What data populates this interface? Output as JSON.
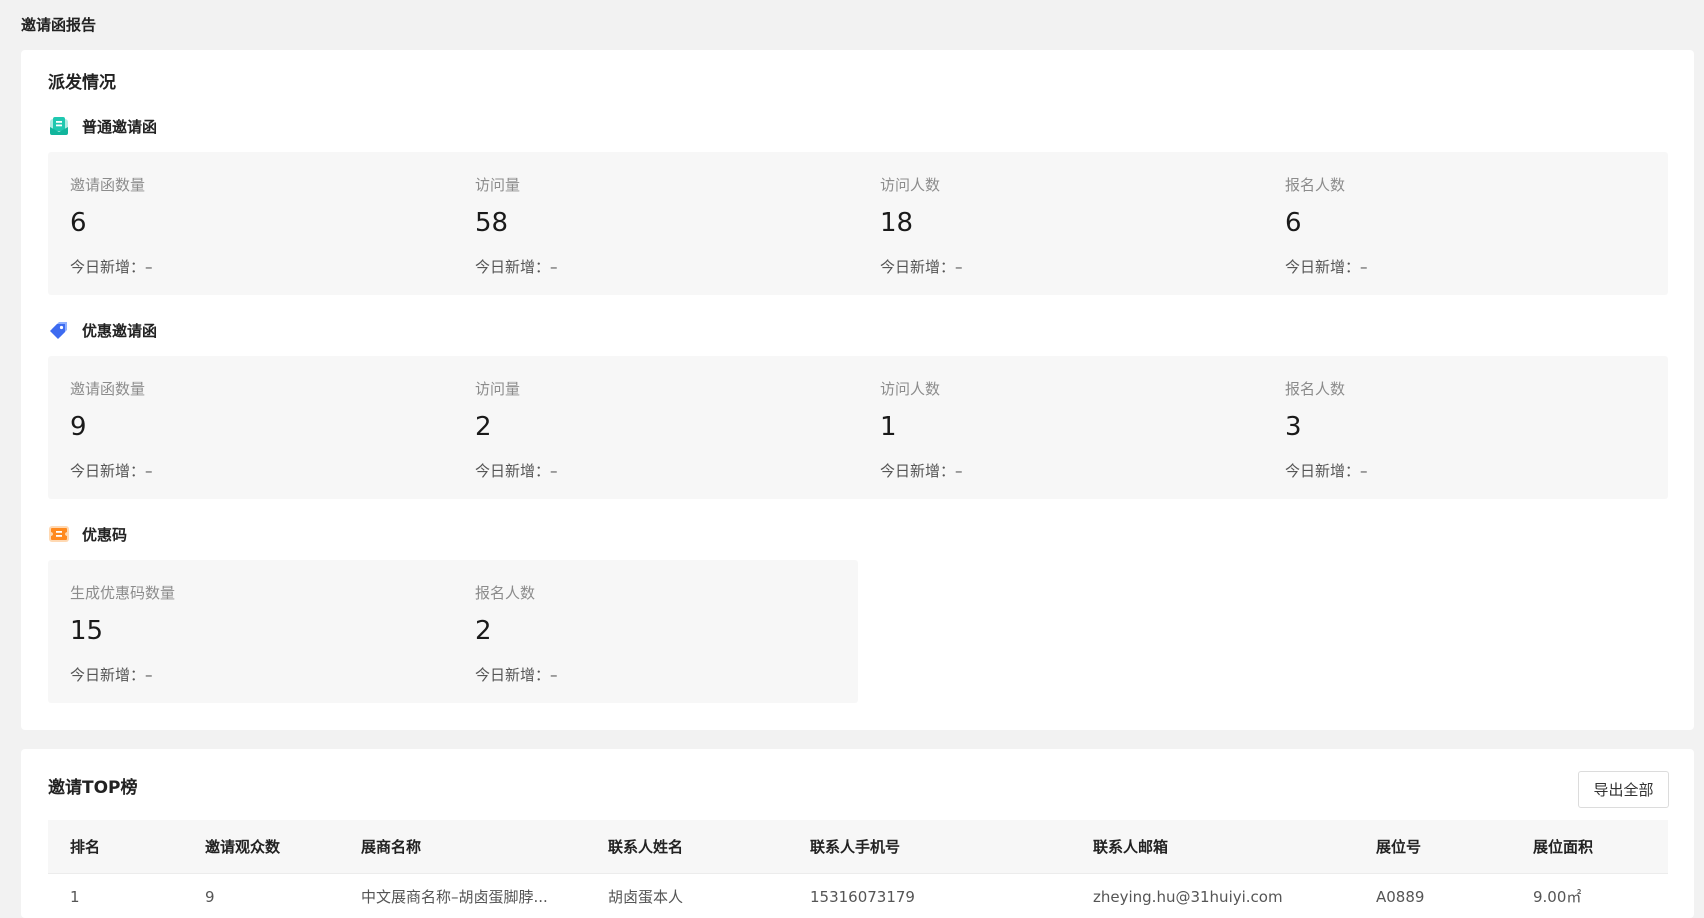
{
  "page": {
    "title": "邀请函报告"
  },
  "distribution": {
    "title": "派发情况",
    "groups": [
      {
        "name": "普通邀请函",
        "icon": "invitation-icon",
        "icon_color": "#1fc8b0",
        "stats": [
          {
            "label": "邀请函数量",
            "value": "6",
            "today": "今日新增：–"
          },
          {
            "label": "访问量",
            "value": "58",
            "today": "今日新增：–"
          },
          {
            "label": "访问人数",
            "value": "18",
            "today": "今日新增：–"
          },
          {
            "label": "报名人数",
            "value": "6",
            "today": "今日新增：–"
          }
        ]
      },
      {
        "name": "优惠邀请函",
        "icon": "coupon-tag-icon",
        "icon_color": "#3d6bf0",
        "stats": [
          {
            "label": "邀请函数量",
            "value": "9",
            "today": "今日新增：–"
          },
          {
            "label": "访问量",
            "value": "2",
            "today": "今日新增：–"
          },
          {
            "label": "访问人数",
            "value": "1",
            "today": "今日新增：–"
          },
          {
            "label": "报名人数",
            "value": "3",
            "today": "今日新增：–"
          }
        ]
      },
      {
        "name": "优惠码",
        "icon": "ticket-icon",
        "icon_color": "#ff8a1f",
        "stats": [
          {
            "label": "生成优惠码数量",
            "value": "15",
            "today": "今日新增：–"
          },
          {
            "label": "报名人数",
            "value": "2",
            "today": "今日新增：–"
          }
        ]
      }
    ]
  },
  "top": {
    "title": "邀请TOP榜",
    "export_label": "导出全部",
    "columns": [
      "排名",
      "邀请观众数",
      "展商名称",
      "联系人姓名",
      "联系人手机号",
      "联系人邮箱",
      "展位号",
      "展位面积"
    ],
    "rows": [
      [
        "1",
        "9",
        "中文展商名称–胡卤蛋脚脖...",
        "胡卤蛋本人",
        "15316073179",
        "zheying.hu@31huiyi.com",
        "A0889",
        "9.00㎡"
      ]
    ]
  }
}
